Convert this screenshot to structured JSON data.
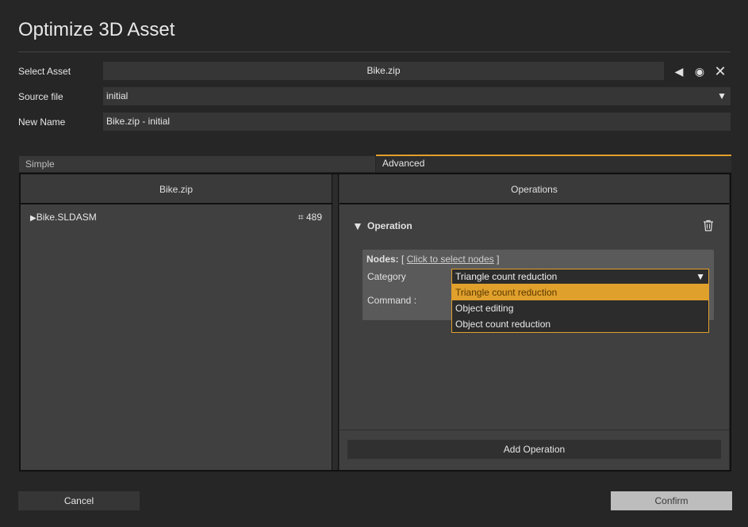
{
  "dialog": {
    "title": "Optimize 3D Asset"
  },
  "form": {
    "select_asset_label": "Select Asset",
    "select_asset_value": "Bike.zip",
    "source_file_label": "Source file",
    "source_file_value": "initial",
    "new_name_label": "New Name",
    "new_name_value": "Bike.zip - initial"
  },
  "tabs": [
    {
      "label": "Simple",
      "active": false
    },
    {
      "label": "Advanced",
      "active": true
    }
  ],
  "left_panel": {
    "header": "Bike.zip",
    "tree": [
      {
        "expand_glyph": "▶",
        "name": "Bike.SLDASM",
        "count_icon": "polygon-count-icon",
        "count": "489"
      }
    ]
  },
  "right_panel": {
    "header": "Operations",
    "operation": {
      "title": "Operation",
      "nodes_label": "Nodes:",
      "nodes_open": "[",
      "nodes_link": "Click to select nodes",
      "nodes_close": "]",
      "category_label": "Category",
      "category_value": "Triangle count reduction",
      "command_label": "Command :",
      "dropdown_options": [
        "Triangle count reduction",
        "Object editing",
        "Object count reduction"
      ]
    },
    "add_operation_label": "Add Operation"
  },
  "footer": {
    "cancel_label": "Cancel",
    "confirm_label": "Confirm"
  },
  "colors": {
    "accent": "#e0a02c",
    "background": "#262626",
    "field": "#363636"
  }
}
